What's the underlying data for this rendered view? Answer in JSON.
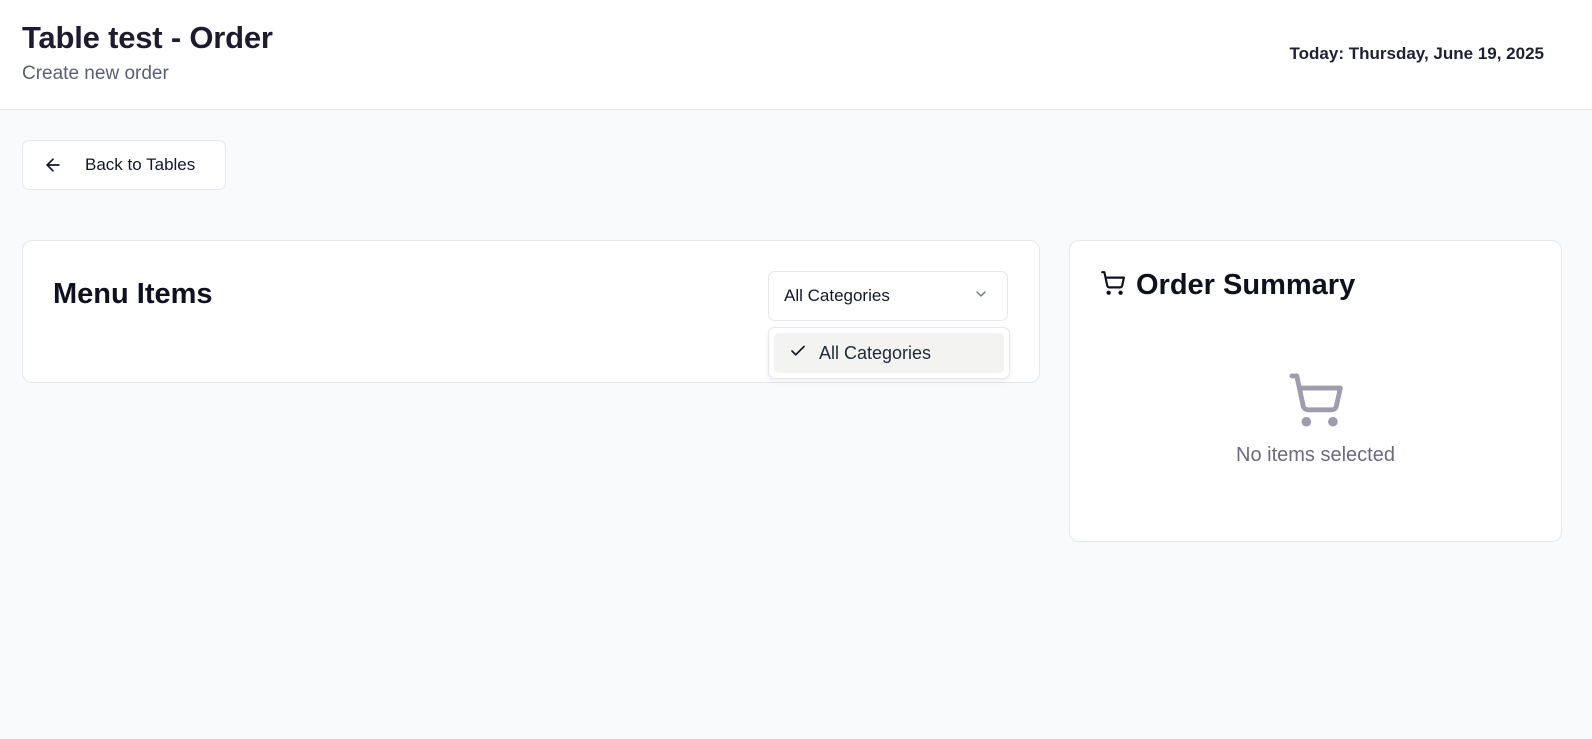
{
  "header": {
    "title": "Table test - Order",
    "subtitle": "Create new order",
    "today": "Today: Thursday, June 19, 2025"
  },
  "back_button": {
    "label": "Back to Tables",
    "icon": "arrow-left-icon"
  },
  "menu": {
    "title": "Menu Items",
    "category_select": {
      "value": "All Categories",
      "options": [
        {
          "label": "All Categories",
          "selected": true
        }
      ]
    }
  },
  "order_summary": {
    "title": "Order Summary",
    "icon": "shopping-cart-icon",
    "empty_icon": "shopping-cart-icon",
    "empty_text": "No items selected"
  },
  "colors": {
    "background": "#f9fafb",
    "card": "#ffffff",
    "border": "#e5e7eb",
    "empty_icon": "#a09cb0",
    "selected_option": "#f3f3f1"
  }
}
